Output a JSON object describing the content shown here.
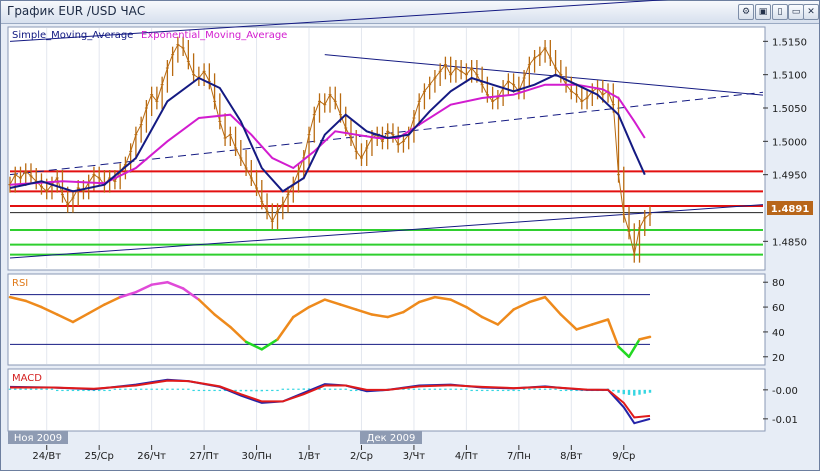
{
  "window": {
    "title": "График EUR /USD  ЧАС",
    "controls": [
      "⚙",
      "▣",
      "▯",
      "▭",
      "✕"
    ]
  },
  "chart_data": [
    {
      "type": "line",
      "panel": "price",
      "legend": [
        "Simple_Moving_Average",
        "Exponential_Moving_Average"
      ],
      "legend_colors": [
        "#101880",
        "#d21ccf"
      ],
      "y_ticks": [
        1.515,
        1.51,
        1.505,
        1.5,
        1.495,
        1.485
      ],
      "y_tick_labels": [
        "1.5150",
        "1.5100",
        "1.5050",
        "1.5000",
        "1.4950",
        "1.4850"
      ],
      "ylim": [
        1.481,
        1.517
      ],
      "xlim": [
        0,
        122
      ],
      "current_price": "1.4891",
      "current_price_value": 1.4891,
      "price_series": [
        [
          0,
          1.4935
        ],
        [
          1,
          1.495
        ],
        [
          2,
          1.4945
        ],
        [
          3,
          1.4955
        ],
        [
          4,
          1.4948
        ],
        [
          5,
          1.494
        ],
        [
          6,
          1.4932
        ],
        [
          7,
          1.4925
        ],
        [
          8,
          1.4935
        ],
        [
          9,
          1.4945
        ],
        [
          10,
          1.492
        ],
        [
          11,
          1.4905
        ],
        [
          12,
          1.4915
        ],
        [
          13,
          1.493
        ],
        [
          14,
          1.4925
        ],
        [
          15,
          1.4938
        ],
        [
          16,
          1.495
        ],
        [
          17,
          1.4945
        ],
        [
          18,
          1.4935
        ],
        [
          19,
          1.4945
        ],
        [
          20,
          1.494
        ],
        [
          21,
          1.4955
        ],
        [
          22,
          1.4965
        ],
        [
          23,
          1.4985
        ],
        [
          24,
          1.501
        ],
        [
          25,
          1.5025
        ],
        [
          26,
          1.505
        ],
        [
          27,
          1.507
        ],
        [
          28,
          1.506
        ],
        [
          29,
          1.5085
        ],
        [
          30,
          1.511
        ],
        [
          31,
          1.513
        ],
        [
          32,
          1.5145
        ],
        [
          33,
          1.514
        ],
        [
          34,
          1.512
        ],
        [
          35,
          1.51
        ],
        [
          36,
          1.5095
        ],
        [
          37,
          1.5105
        ],
        [
          38,
          1.509
        ],
        [
          39,
          1.506
        ],
        [
          40,
          1.503
        ],
        [
          41,
          1.5005
        ],
        [
          42,
          1.501
        ],
        [
          43,
          1.499
        ],
        [
          44,
          1.4975
        ],
        [
          45,
          1.496
        ],
        [
          46,
          1.4945
        ],
        [
          47,
          1.493
        ],
        [
          48,
          1.491
        ],
        [
          49,
          1.4895
        ],
        [
          50,
          1.488
        ],
        [
          51,
          1.4895
        ],
        [
          52,
          1.4905
        ],
        [
          53,
          1.492
        ],
        [
          54,
          1.4935
        ],
        [
          55,
          1.4955
        ],
        [
          56,
          1.4975
        ],
        [
          57,
          1.501
        ],
        [
          58,
          1.504
        ],
        [
          59,
          1.506
        ],
        [
          60,
          1.5055
        ],
        [
          61,
          1.507
        ],
        [
          62,
          1.506
        ],
        [
          63,
          1.504
        ],
        [
          64,
          1.502
        ],
        [
          65,
          1.5005
        ],
        [
          66,
          1.4985
        ],
        [
          67,
          1.4975
        ],
        [
          68,
          1.499
        ],
        [
          69,
          1.5005
        ],
        [
          70,
          1.501
        ],
        [
          71,
          1.5
        ],
        [
          72,
          1.5015
        ],
        [
          73,
          1.501
        ],
        [
          74,
          1.4995
        ],
        [
          75,
          1.5
        ],
        [
          76,
          1.501
        ],
        [
          77,
          1.5035
        ],
        [
          78,
          1.506
        ],
        [
          79,
          1.5075
        ],
        [
          80,
          1.5085
        ],
        [
          81,
          1.5095
        ],
        [
          82,
          1.5105
        ],
        [
          83,
          1.5115
        ],
        [
          84,
          1.51
        ],
        [
          85,
          1.511
        ],
        [
          86,
          1.5105
        ],
        [
          87,
          1.51
        ],
        [
          88,
          1.511
        ],
        [
          89,
          1.51
        ],
        [
          90,
          1.5085
        ],
        [
          91,
          1.507
        ],
        [
          92,
          1.506
        ],
        [
          93,
          1.5065
        ],
        [
          94,
          1.508
        ],
        [
          95,
          1.509
        ],
        [
          96,
          1.5085
        ],
        [
          97,
          1.5075
        ],
        [
          98,
          1.5095
        ],
        [
          99,
          1.5115
        ],
        [
          100,
          1.5125
        ],
        [
          101,
          1.513
        ],
        [
          102,
          1.514
        ],
        [
          103,
          1.5125
        ],
        [
          104,
          1.511
        ],
        [
          105,
          1.51
        ],
        [
          106,
          1.5085
        ],
        [
          107,
          1.5075
        ],
        [
          108,
          1.507
        ],
        [
          109,
          1.506
        ],
        [
          110,
          1.5065
        ],
        [
          111,
          1.5075
        ],
        [
          112,
          1.508
        ],
        [
          113,
          1.507
        ],
        [
          114,
          1.5075
        ],
        [
          115,
          1.5055
        ],
        [
          116,
          1.495
        ],
        [
          117,
          1.489
        ],
        [
          118,
          1.4865
        ],
        [
          119,
          1.483
        ],
        [
          120,
          1.487
        ],
        [
          121,
          1.4885
        ],
        [
          122,
          1.4891
        ]
      ],
      "sma_series": [
        [
          0,
          1.493
        ],
        [
          6,
          1.494
        ],
        [
          12,
          1.4925
        ],
        [
          18,
          1.4935
        ],
        [
          24,
          1.4975
        ],
        [
          30,
          1.506
        ],
        [
          36,
          1.5095
        ],
        [
          40,
          1.508
        ],
        [
          44,
          1.503
        ],
        [
          48,
          1.496
        ],
        [
          52,
          1.4925
        ],
        [
          56,
          1.4945
        ],
        [
          60,
          1.501
        ],
        [
          64,
          1.504
        ],
        [
          68,
          1.5015
        ],
        [
          72,
          1.5005
        ],
        [
          76,
          1.501
        ],
        [
          80,
          1.5045
        ],
        [
          84,
          1.5075
        ],
        [
          88,
          1.5095
        ],
        [
          92,
          1.5085
        ],
        [
          96,
          1.5075
        ],
        [
          100,
          1.5085
        ],
        [
          104,
          1.51
        ],
        [
          108,
          1.5085
        ],
        [
          112,
          1.507
        ],
        [
          116,
          1.504
        ],
        [
          119,
          1.4985
        ],
        [
          121,
          1.495
        ]
      ],
      "ema_series": [
        [
          0,
          1.4935
        ],
        [
          10,
          1.494
        ],
        [
          18,
          1.4937
        ],
        [
          24,
          1.496
        ],
        [
          30,
          1.5
        ],
        [
          36,
          1.5035
        ],
        [
          42,
          1.504
        ],
        [
          46,
          1.501
        ],
        [
          50,
          1.4975
        ],
        [
          54,
          1.496
        ],
        [
          58,
          1.4985
        ],
        [
          62,
          1.5015
        ],
        [
          66,
          1.501
        ],
        [
          70,
          1.5005
        ],
        [
          74,
          1.5005
        ],
        [
          78,
          1.5025
        ],
        [
          84,
          1.5055
        ],
        [
          90,
          1.5065
        ],
        [
          96,
          1.507
        ],
        [
          102,
          1.5085
        ],
        [
          108,
          1.5085
        ],
        [
          113,
          1.5078
        ],
        [
          116,
          1.5065
        ],
        [
          119,
          1.503
        ],
        [
          121,
          1.5005
        ]
      ],
      "red_levels": [
        1.4955,
        1.4925,
        1.4903
      ],
      "green_levels": [
        1.4867,
        1.4845,
        1.483
      ],
      "black_level": 1.4893,
      "trendlines": [
        {
          "style": "solid",
          "from": [
            0,
            1.515
          ],
          "to": [
            60,
            1.518
          ]
        },
        {
          "style": "solid",
          "from": [
            60,
            1.513
          ],
          "to": [
            122,
            1.5085
          ]
        },
        {
          "style": "dashed",
          "from": [
            0,
            1.495
          ],
          "to": [
            122,
            1.5055
          ]
        },
        {
          "style": "solid",
          "from": [
            0,
            1.4825
          ],
          "to": [
            122,
            1.4893
          ]
        }
      ]
    },
    {
      "type": "line",
      "panel": "rsi",
      "label": "RSI",
      "y_ticks": [
        80,
        60,
        40,
        20
      ],
      "y_tick_labels": [
        "80",
        "60",
        "40",
        "20"
      ],
      "ylim": [
        15,
        85
      ],
      "levels": [
        70,
        30
      ],
      "series": [
        [
          0,
          68
        ],
        [
          3,
          65
        ],
        [
          6,
          60
        ],
        [
          9,
          54
        ],
        [
          12,
          48
        ],
        [
          15,
          55
        ],
        [
          18,
          62
        ],
        [
          21,
          68
        ],
        [
          24,
          72
        ],
        [
          27,
          78
        ],
        [
          30,
          80
        ],
        [
          33,
          75
        ],
        [
          36,
          66
        ],
        [
          39,
          54
        ],
        [
          42,
          44
        ],
        [
          45,
          32
        ],
        [
          48,
          26
        ],
        [
          51,
          34
        ],
        [
          54,
          52
        ],
        [
          57,
          60
        ],
        [
          60,
          66
        ],
        [
          63,
          62
        ],
        [
          66,
          58
        ],
        [
          69,
          54
        ],
        [
          72,
          52
        ],
        [
          75,
          56
        ],
        [
          78,
          64
        ],
        [
          81,
          68
        ],
        [
          84,
          66
        ],
        [
          87,
          60
        ],
        [
          90,
          52
        ],
        [
          93,
          46
        ],
        [
          96,
          58
        ],
        [
          99,
          64
        ],
        [
          102,
          68
        ],
        [
          105,
          54
        ],
        [
          108,
          42
        ],
        [
          111,
          46
        ],
        [
          114,
          50
        ],
        [
          116,
          28
        ],
        [
          118,
          20
        ],
        [
          120,
          34
        ],
        [
          122,
          36
        ]
      ]
    },
    {
      "type": "line",
      "panel": "macd",
      "label": "MACD",
      "y_ticks": [
        0.0,
        -0.01
      ],
      "y_tick_labels": [
        "-0.00",
        "-0.01"
      ],
      "ylim": [
        -0.0135,
        0.0065
      ],
      "macd_series": [
        [
          0,
          0.001
        ],
        [
          8,
          0.0008
        ],
        [
          16,
          0.0002
        ],
        [
          24,
          0.0018
        ],
        [
          30,
          0.0035
        ],
        [
          34,
          0.003
        ],
        [
          40,
          0.001
        ],
        [
          44,
          -0.002
        ],
        [
          48,
          -0.0045
        ],
        [
          52,
          -0.004
        ],
        [
          56,
          -0.001
        ],
        [
          60,
          0.002
        ],
        [
          64,
          0.0015
        ],
        [
          68,
          -0.0005
        ],
        [
          72,
          0.0
        ],
        [
          78,
          0.0015
        ],
        [
          84,
          0.0018
        ],
        [
          90,
          0.0008
        ],
        [
          96,
          0.0005
        ],
        [
          102,
          0.0012
        ],
        [
          106,
          0.0005
        ],
        [
          110,
          0.0
        ],
        [
          114,
          0.0
        ],
        [
          117,
          -0.006
        ],
        [
          119,
          -0.0115
        ],
        [
          122,
          -0.01
        ]
      ],
      "signal_series": [
        [
          0,
          0.0008
        ],
        [
          8,
          0.0008
        ],
        [
          16,
          0.0004
        ],
        [
          24,
          0.0015
        ],
        [
          30,
          0.0032
        ],
        [
          34,
          0.003
        ],
        [
          40,
          0.0012
        ],
        [
          44,
          -0.0015
        ],
        [
          48,
          -0.004
        ],
        [
          52,
          -0.004
        ],
        [
          56,
          -0.0015
        ],
        [
          60,
          0.0015
        ],
        [
          64,
          0.0015
        ],
        [
          68,
          0.0
        ],
        [
          72,
          0.0
        ],
        [
          78,
          0.0012
        ],
        [
          84,
          0.0016
        ],
        [
          90,
          0.001
        ],
        [
          96,
          0.0006
        ],
        [
          102,
          0.001
        ],
        [
          106,
          0.0006
        ],
        [
          110,
          0.0001
        ],
        [
          114,
          0.0
        ],
        [
          117,
          -0.0045
        ],
        [
          119,
          -0.0095
        ],
        [
          122,
          -0.009
        ]
      ]
    }
  ],
  "x_axis": {
    "labels": [
      "24/Вт",
      "25/Ср",
      "26/Чт",
      "27/Пт",
      "30/Пн",
      "1/Вт",
      "2/Ср",
      "3/Чт",
      "4/Пт",
      "7/Пн",
      "8/Вт",
      "9/Ср"
    ],
    "tick_positions": [
      7,
      17,
      27,
      37,
      47,
      57,
      67,
      77,
      87,
      97,
      107,
      117
    ],
    "month_labels": [
      "Ноя 2009",
      "Дек 2009"
    ]
  },
  "colors": {
    "price": "#b86a10",
    "sma": "#141a82",
    "ema": "#d21ccf",
    "red_level": "#e21010",
    "green_level": "#2fcf2f",
    "rsi": "#ee8a1c",
    "rsi_high": "#e04ad8",
    "rsi_low": "#22d822",
    "macd": "#2424a8",
    "signal": "#e01a1a",
    "histogram": "#36d6e2",
    "price_box": "#b8661a"
  }
}
